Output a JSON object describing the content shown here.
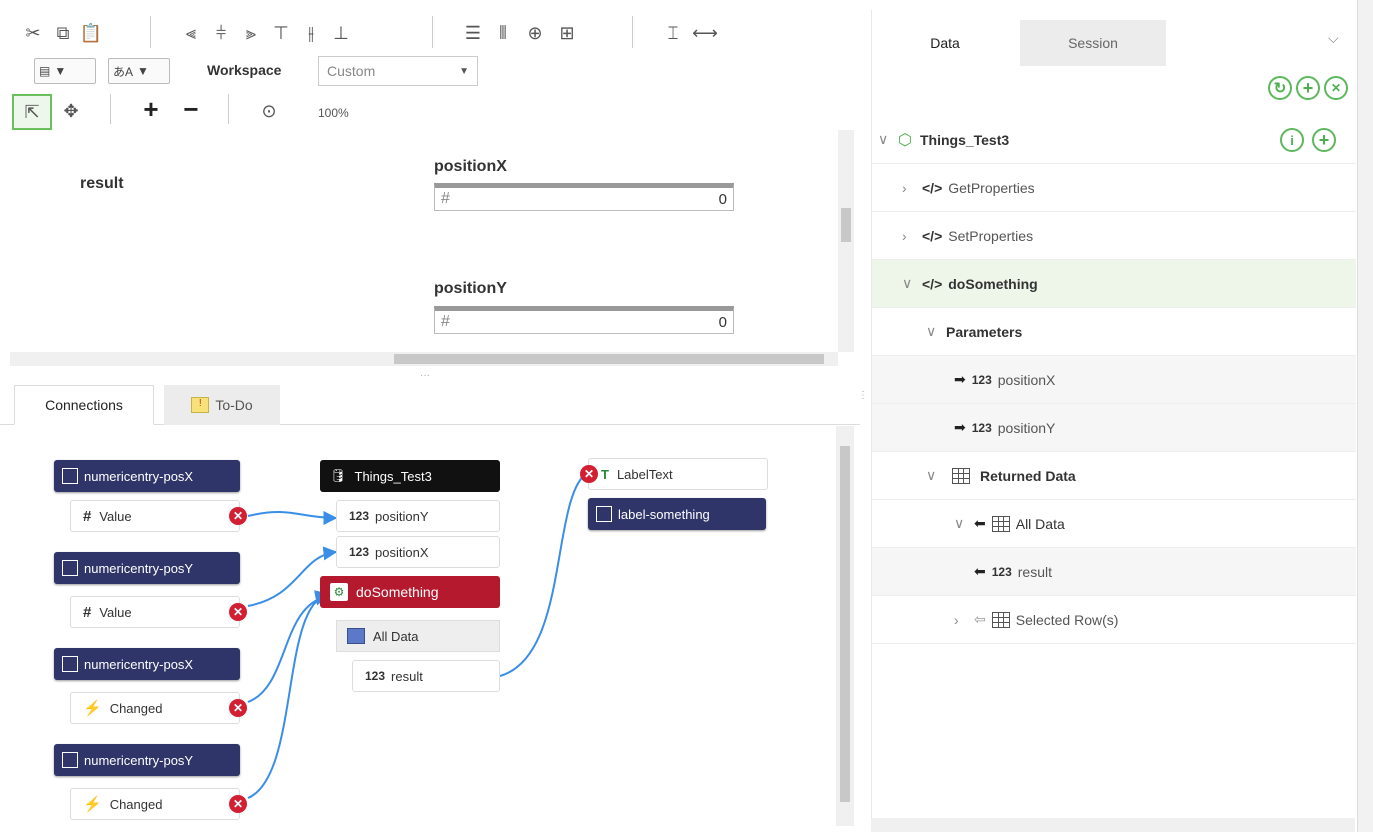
{
  "toolbar": {
    "workspace_label": "Workspace",
    "workspace_value": "Custom",
    "zoom": "100%",
    "icons": [
      "cut-icon",
      "copy-icon",
      "paste-icon",
      "align-left-icon",
      "align-center-icon",
      "align-right-icon",
      "align-top-icon",
      "align-middle-icon",
      "align-bottom-icon",
      "distribute-vertical-icon",
      "distribute-horizontal-icon",
      "center-icon",
      "fit-icon",
      "same-height-icon",
      "same-width-icon",
      "select-icon",
      "pan-icon",
      "zoom-in-icon",
      "zoom-out-icon",
      "target-icon"
    ]
  },
  "canvas": {
    "result_label": "result",
    "positionX_label": "positionX",
    "positionX_value": "0",
    "positionY_label": "positionY",
    "positionY_value": "0",
    "hash": "#"
  },
  "connections": {
    "tabs": [
      {
        "label": "Connections"
      },
      {
        "label": "To-Do"
      }
    ],
    "sources": [
      {
        "widget": "numericentry-posX",
        "port": "Value"
      },
      {
        "widget": "numericentry-posY",
        "port": "Value"
      },
      {
        "widget": "numericentry-posX",
        "port": "Changed"
      },
      {
        "widget": "numericentry-posY",
        "port": "Changed"
      }
    ],
    "thing": "Things_Test3",
    "params": [
      {
        "prefix": "123",
        "name": "positionY"
      },
      {
        "prefix": "123",
        "name": "positionX"
      }
    ],
    "service": "doSomething",
    "all_data": "All Data",
    "result": {
      "prefix": "123",
      "name": "result"
    },
    "target_prop": "LabelText",
    "target_widget": "label-something"
  },
  "right_panel": {
    "tabs": [
      {
        "label": "Data"
      },
      {
        "label": "Session"
      }
    ],
    "thing": "Things_Test3",
    "services": [
      {
        "label": "GetProperties"
      },
      {
        "label": "SetProperties"
      },
      {
        "label": "doSomething"
      }
    ],
    "parameters_label": "Parameters",
    "params": [
      {
        "prefix": "123",
        "name": "positionX"
      },
      {
        "prefix": "123",
        "name": "positionY"
      }
    ],
    "returned_data": "Returned Data",
    "all_data": "All Data",
    "result": {
      "prefix": "123",
      "name": "result"
    },
    "selected_rows": "Selected Row(s)"
  },
  "colors": {
    "accent_green": "#5cb85c",
    "node_dark": "#2f3469",
    "node_red": "#b5192d",
    "connector_blue": "#3b8ee8"
  }
}
